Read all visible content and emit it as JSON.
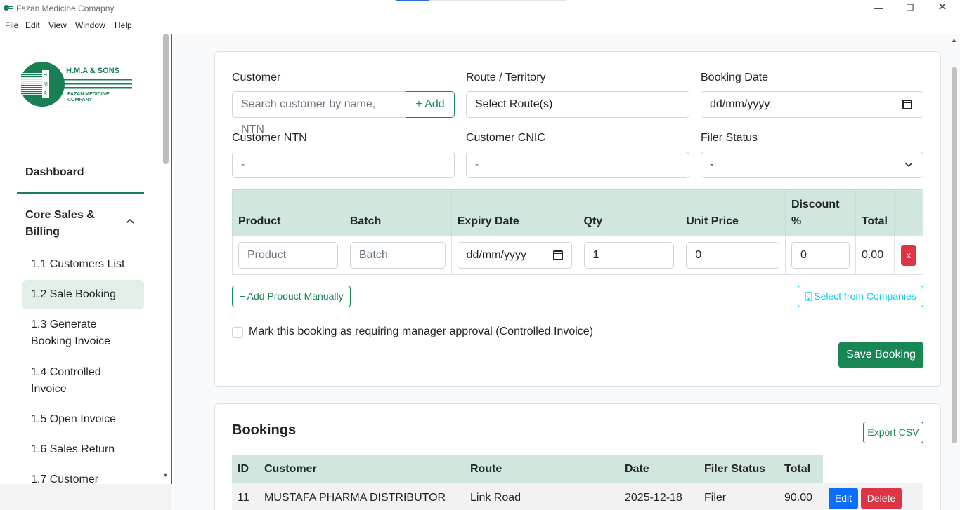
{
  "window": {
    "title": "Fazan Medicine Comapny",
    "controls": {
      "minimize": "—",
      "maximize": "❐",
      "close": "✕"
    }
  },
  "menu": [
    "File",
    "Edit",
    "View",
    "Window",
    "Help"
  ],
  "logo": {
    "line1": "H.M.A & SONS",
    "line2": "FAZAN MEDICINE",
    "line3": "COMPANY",
    "letters": [
      "H",
      "M",
      "A"
    ]
  },
  "sidebar": {
    "dashboard": "Dashboard",
    "group": "Core Sales & Billing",
    "items": [
      {
        "label": "1.1 Customers List",
        "active": false
      },
      {
        "label": "1.2 Sale Booking",
        "active": true
      },
      {
        "label": "1.3 Generate Booking Invoice",
        "active": false
      },
      {
        "label": "1.4 Controlled Invoice",
        "active": false
      },
      {
        "label": "1.5 Open Invoice",
        "active": false
      },
      {
        "label": "1.6 Sales Return",
        "active": false
      },
      {
        "label": "1.7 Customer",
        "active": false
      }
    ]
  },
  "form": {
    "customer_label": "Customer",
    "customer_placeholder": "Search customer by name, NTN",
    "add_button": "+ Add",
    "route_label": "Route / Territory",
    "route_value": "Select Route(s)",
    "booking_date_label": "Booking Date",
    "booking_date_value": "dd/mm/yyyy",
    "ntn_label": "Customer NTN",
    "ntn_value": "-",
    "cnic_label": "Customer CNIC",
    "cnic_value": "-",
    "filer_label": "Filer Status",
    "filer_value": "-"
  },
  "product_table": {
    "headers": [
      "Product",
      "Batch",
      "Expiry Date",
      "Qty",
      "Unit Price",
      "Discount %",
      "Total",
      ""
    ],
    "row": {
      "product_placeholder": "Product",
      "batch_placeholder": "Batch",
      "expiry_value": "dd/mm/yyyy",
      "qty": "1",
      "unit_price": "0",
      "discount": "0",
      "total": "0.00",
      "remove": "x"
    }
  },
  "actions": {
    "add_product": "+ Add Product Manually",
    "select_companies": "Select from Companies",
    "approval_label": "Mark this booking as requiring manager approval (Controlled Invoice)",
    "save": "Save Booking"
  },
  "bookings": {
    "title": "Bookings",
    "export": "Export CSV",
    "headers": [
      "ID",
      "Customer",
      "Route",
      "Date",
      "Filer Status",
      "Total"
    ],
    "rows": [
      {
        "id": "11",
        "customer": "MUSTAFA PHARMA DISTRIBUTOR",
        "route": "Link Road",
        "date": "2025-12-18",
        "filer": "Filer",
        "total": "90.00"
      }
    ],
    "edit": "Edit",
    "delete": "Delete"
  },
  "colors": {
    "primary": "#198754",
    "header_bg": "#d1e7dd",
    "danger": "#dc3545",
    "info": "#0dcaf0",
    "blue": "#0d6efd"
  }
}
